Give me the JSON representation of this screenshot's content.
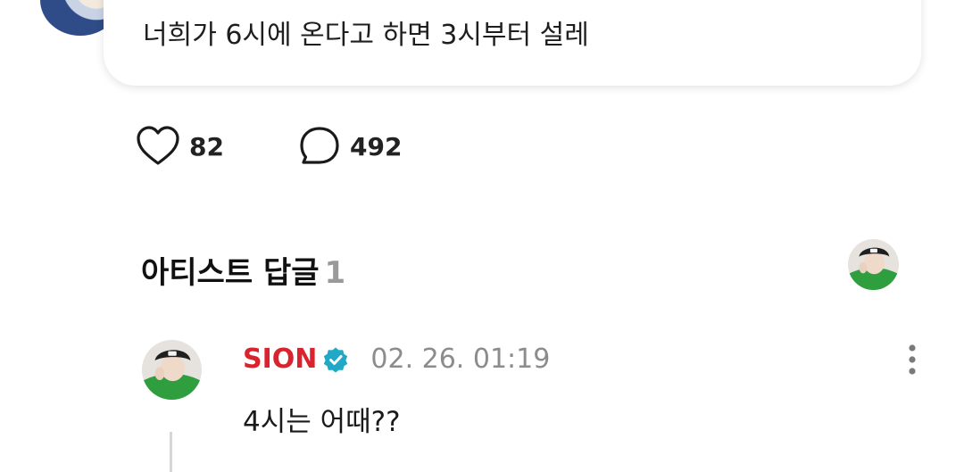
{
  "post": {
    "text": "너희가 6시에 온다고 하면 3시부터 설레"
  },
  "actions": {
    "like_count": "82",
    "comment_count": "492"
  },
  "artist_replies": {
    "title": "아티스트 답글",
    "count": "1"
  },
  "reply": {
    "author": "SION",
    "timestamp": "02. 26. 01:19",
    "text": "4시는 어때??"
  },
  "icons": {
    "like": "heart-outline-icon",
    "comment": "speech-bubble-icon",
    "verified": "verified-check-icon",
    "more": "more-vertical-icon"
  },
  "colors": {
    "author_name": "#d9232d",
    "verified_badge": "#1fa9c7",
    "timestamp": "#8c8c8c",
    "count_muted": "#9a9a9a"
  }
}
